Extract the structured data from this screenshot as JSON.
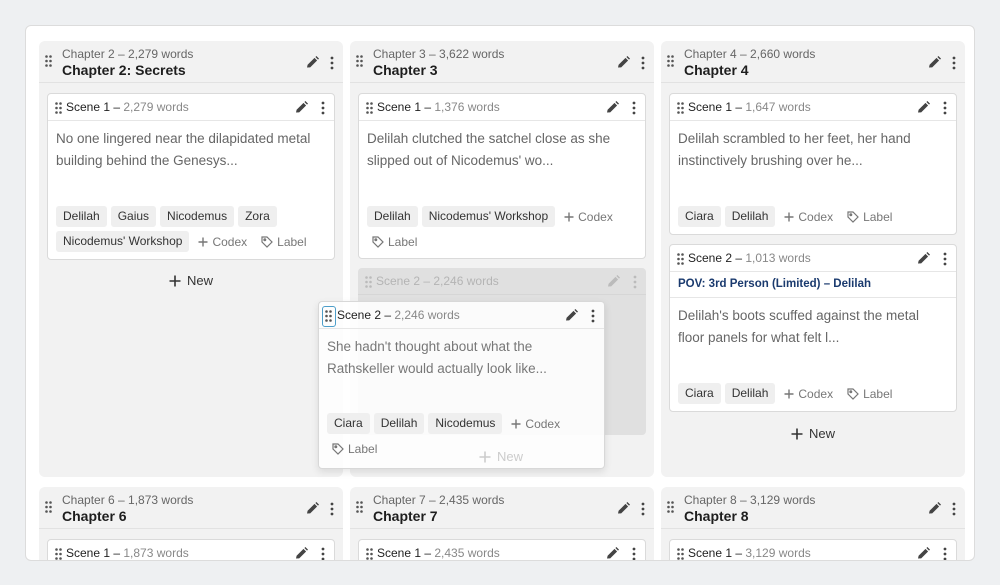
{
  "columns": [
    {
      "meta": "Chapter 2  –  2,279 words",
      "title": "Chapter 2: Secrets",
      "scenes": [
        {
          "label": "Scene 1 – ",
          "words": "2,279 words",
          "summary": "No one lingered near the dilapidated metal building behind the Genesys...",
          "tags": [
            "Delilah",
            "Gaius",
            "Nicodemus",
            "Zora",
            "Nicodemus' Workshop"
          ]
        }
      ],
      "new_label": "New"
    },
    {
      "meta": "Chapter 3  –  3,622 words",
      "title": "Chapter 3",
      "scenes": [
        {
          "label": "Scene 1 – ",
          "words": "1,376 words",
          "summary": "Delilah clutched the satchel close as she slipped out of Nicodemus' wo...",
          "tags": [
            "Delilah",
            "Nicodemus' Workshop"
          ]
        }
      ],
      "ghost": {
        "label": "Scene 2 – ",
        "words": "2,246 words",
        "summary_fragment": "hadn't thought about what the",
        "summary_fragment2": "Rathskeller would actually look like...",
        "tags": [
          "Ciara",
          "Delilah",
          "Nicodemus"
        ],
        "codex": "Codex",
        "new_label": "New"
      },
      "new_label": "New"
    },
    {
      "meta": "Chapter 4  –  2,660 words",
      "title": "Chapter 4",
      "scenes": [
        {
          "label": "Scene 1 – ",
          "words": "1,647 words",
          "summary": "Delilah scrambled to her feet, her hand instinctively brushing over he...",
          "tags": [
            "Ciara",
            "Delilah"
          ]
        },
        {
          "label": "Scene 2 – ",
          "words": "1,013 words",
          "pov": "POV: 3rd Person (Limited) – Delilah",
          "summary": "Delilah's boots scuffed against the metal floor panels for what felt l...",
          "tags": [
            "Ciara",
            "Delilah"
          ]
        }
      ],
      "new_label": "New"
    }
  ],
  "bottom_columns": [
    {
      "meta": "Chapter 6  –  1,873 words",
      "title": "Chapter 6",
      "scene_label": "Scene 1 – ",
      "scene_words": "1,873 words"
    },
    {
      "meta": "Chapter 7  –  2,435 words",
      "title": "Chapter 7",
      "scene_label": "Scene 1 – ",
      "scene_words": "2,435 words"
    },
    {
      "meta": "Chapter 8  –  3,129 words",
      "title": "Chapter 8",
      "scene_label": "Scene 1 – ",
      "scene_words": "3,129 words"
    }
  ],
  "dragged": {
    "label": "Scene 2 – ",
    "words": "2,246 words",
    "summary": "She hadn't thought about what the Rathskeller would actually look like...",
    "tags": [
      "Ciara",
      "Delilah",
      "Nicodemus"
    ]
  },
  "actions": {
    "codex": "Codex",
    "label": "Label",
    "new": "New"
  },
  "icons": {
    "drag": "drag-handle-icon",
    "edit": "pencil-icon",
    "more": "more-vertical-icon",
    "plus": "plus-icon",
    "tag": "tag-icon"
  }
}
